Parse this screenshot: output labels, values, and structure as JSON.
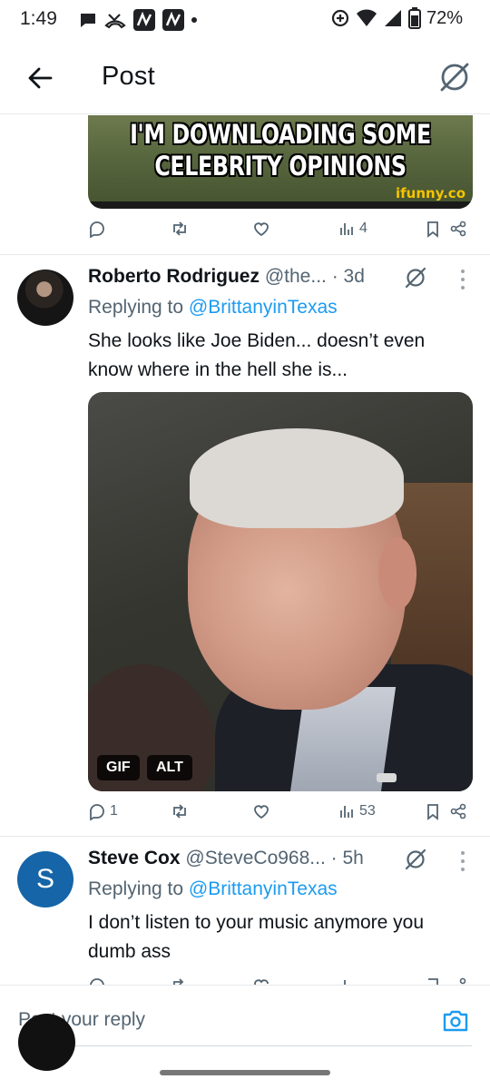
{
  "status_bar": {
    "time": "1:49",
    "battery_percent": "72%",
    "left_icons": [
      "chat-bubble-icon",
      "missed-call-icon",
      "app-n-icon",
      "app-n-icon",
      "dot-icon"
    ],
    "right_icons": [
      "data-saver-icon",
      "wifi-icon",
      "signal-icon",
      "battery-icon"
    ]
  },
  "header": {
    "title": "Post",
    "back_icon": "arrow-left-icon",
    "grok_icon": "grok-icon"
  },
  "previous_post": {
    "image_text_line1": "I'M DOWNLOADING SOME",
    "image_text_line2": "CELEBRITY OPINIONS",
    "image_watermark": "ifunny.co",
    "views": "4"
  },
  "replies": [
    {
      "name": "Roberto Rodriguez",
      "handle": "@the...",
      "time": "· 3d",
      "replying_label": "Replying to",
      "replying_to": "@BrittanyinTexas",
      "text": "She looks like Joe Biden... doesn’t even know where in the hell she is...",
      "media_badges": [
        "GIF",
        "ALT"
      ],
      "reply_count": "1",
      "views": "53"
    },
    {
      "name": "Steve Cox",
      "handle": "@SteveCo968...",
      "time": "· 5h",
      "avatar_letter": "S",
      "replying_label": "Replying to",
      "replying_to": "@BrittanyinTexas",
      "text": "I don’t listen to your music anymore you dumb ass"
    }
  ],
  "composer": {
    "placeholder": "Post your reply"
  },
  "colors": {
    "accent": "#1d9bf0",
    "secondary_text": "#536471",
    "primary_text": "#0f1419",
    "avatar_s": "#1565a8"
  }
}
